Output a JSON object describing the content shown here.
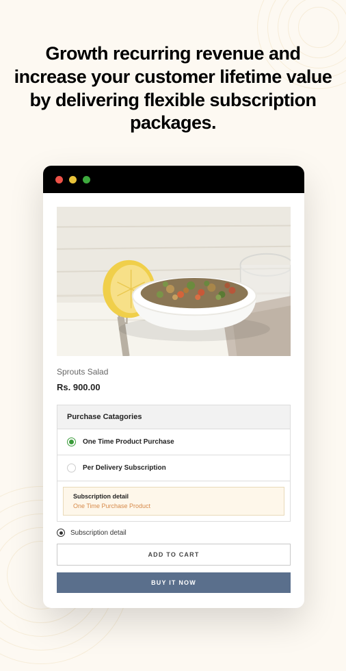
{
  "headline": "Growth recurring revenue and increase your customer lifetime value by delivering flexible subscription packages.",
  "product": {
    "title": "Sprouts Salad",
    "price": "Rs. 900.00"
  },
  "purchase": {
    "header": "Purchase Catagories",
    "options": [
      {
        "label": "One Time Product Purchase",
        "selected": true
      },
      {
        "label": "Per Delivery Subscription",
        "selected": false
      }
    ],
    "detail": {
      "label": "Subscription detail",
      "text": "One Time Purchase Product"
    },
    "subDetailRow": "Subscription detail"
  },
  "buttons": {
    "addToCart": "ADD TO CART",
    "buyNow": "BUY IT NOW"
  }
}
